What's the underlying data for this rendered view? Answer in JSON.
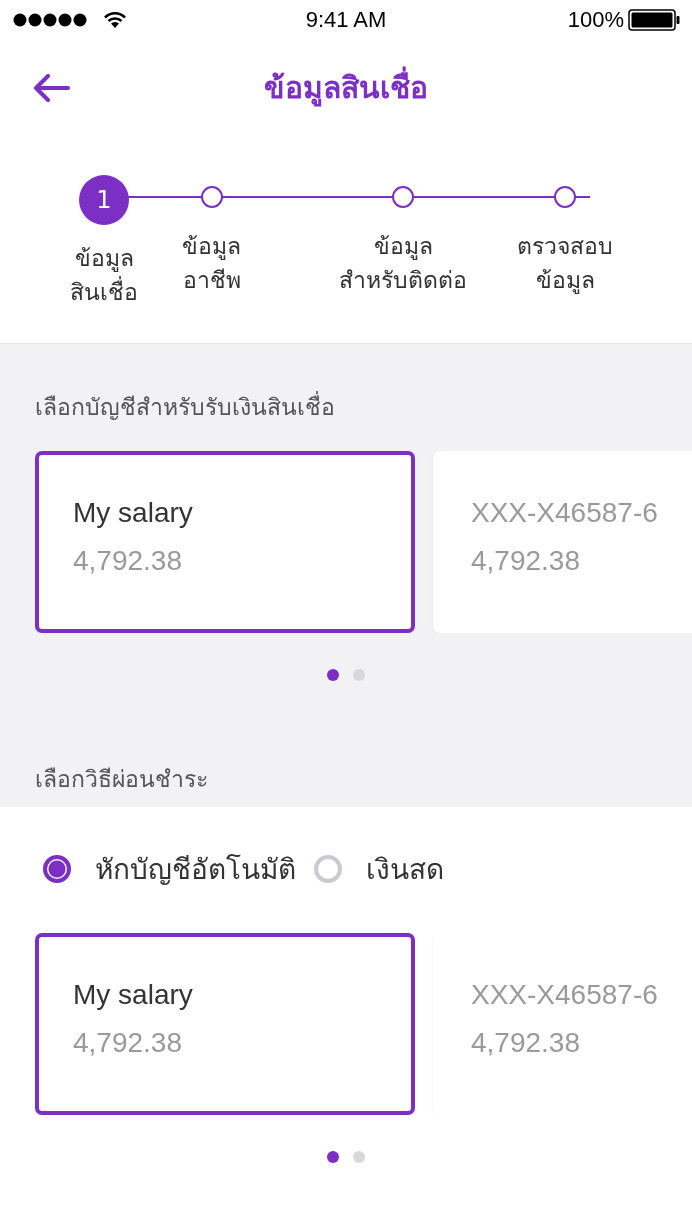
{
  "status_bar": {
    "time": "9:41 AM",
    "battery": "100%"
  },
  "header": {
    "title": "ข้อมูลสินเชื่อ"
  },
  "steps": [
    {
      "number": "1",
      "lines": [
        "ข้อมูล",
        "สินเชื่อ"
      ],
      "selected": true
    },
    {
      "lines": [
        "ข้อมูล",
        "อาชีพ"
      ],
      "selected": false
    },
    {
      "lines": [
        "ข้อมูล",
        "สำหรับติดต่อ"
      ],
      "selected": false
    },
    {
      "lines": [
        "ตรวจสอบ",
        "ข้อมูล"
      ],
      "selected": false
    }
  ],
  "receive_section": {
    "title": "เลือกบัญชีสำหรับรับเงินสินเชื่อ",
    "accounts": [
      {
        "name": "My salary",
        "balance": "4,792.38",
        "selected": true
      },
      {
        "name": "XXX-X46587-6",
        "balance": "4,792.38",
        "selected": false
      }
    ],
    "pages": [
      {
        "selected": true
      },
      {
        "selected": false
      }
    ]
  },
  "payment_section": {
    "title": "เลือกวิธีผ่อนชำระ",
    "methods": [
      {
        "label": "หักบัญชีอัตโนมัติ",
        "selected": true
      },
      {
        "label": "เงินสด",
        "selected": false
      }
    ],
    "accounts": [
      {
        "name": "My salary",
        "balance": "4,792.38",
        "selected": true
      },
      {
        "name": "XXX-X46587-6",
        "balance": "4,792.38",
        "selected": false
      }
    ],
    "pages": [
      {
        "selected": true
      },
      {
        "selected": false
      }
    ]
  }
}
